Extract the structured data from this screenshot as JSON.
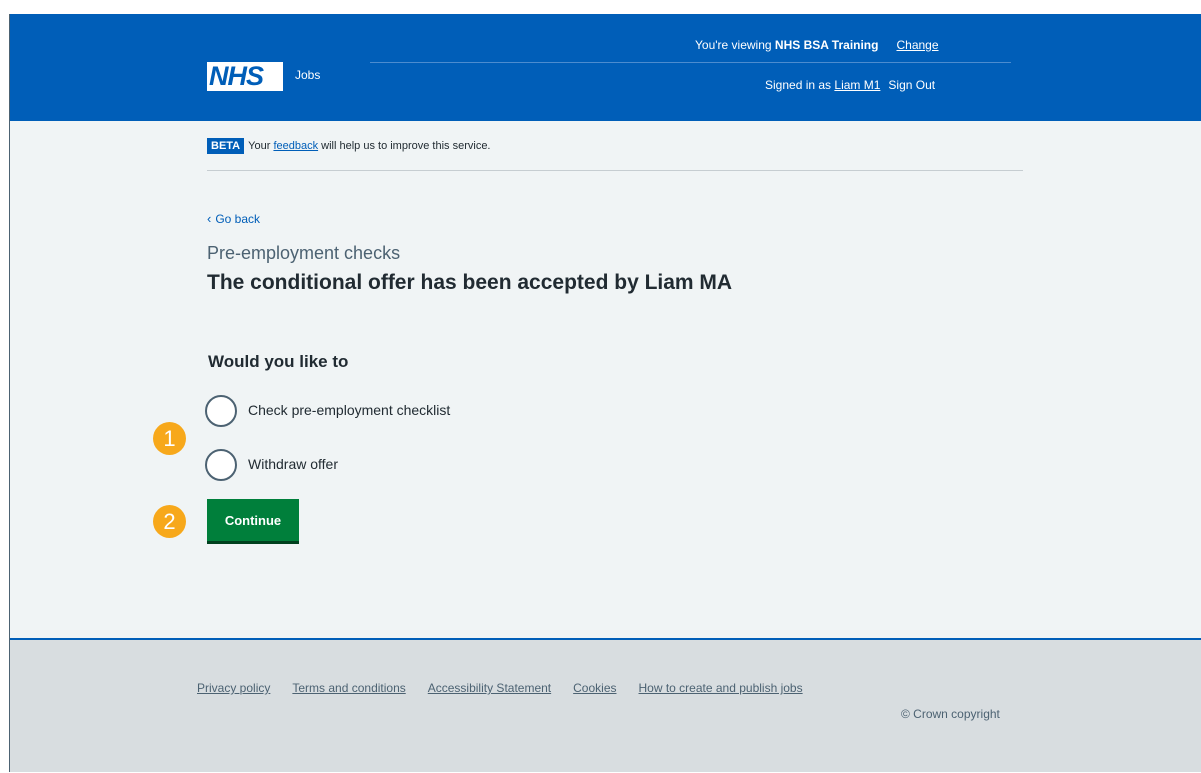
{
  "header": {
    "viewing_prefix": "You're viewing ",
    "org_name": "NHS BSA Training",
    "change_label": "Change",
    "signed_in_prefix": "Signed in as ",
    "user_name": "Liam M1",
    "sign_out_label": "Sign Out",
    "logo_text": "NHS",
    "service_name": "Jobs"
  },
  "beta": {
    "tag": "BETA",
    "text_before": "Your ",
    "feedback_link": "feedback",
    "text_after": " will help us to improve this service."
  },
  "main": {
    "go_back": "Go back",
    "caption": "Pre-employment checks",
    "title": "The conditional offer has been accepted by Liam MA",
    "question": "Would you like to",
    "options": [
      {
        "label": "Check pre-employment checklist",
        "selected": false
      },
      {
        "label": "Withdraw offer",
        "selected": false
      }
    ],
    "continue_label": "Continue"
  },
  "markers": [
    "1",
    "2"
  ],
  "footer": {
    "links": [
      "Privacy policy",
      "Terms and conditions",
      "Accessibility Statement",
      "Cookies",
      "How to create and publish jobs"
    ],
    "copyright": "© Crown copyright"
  },
  "colors": {
    "nhs_blue": "#005eb8",
    "button_green": "#007f3b",
    "marker_orange": "#f7a81b",
    "page_bg": "#f0f4f5"
  }
}
